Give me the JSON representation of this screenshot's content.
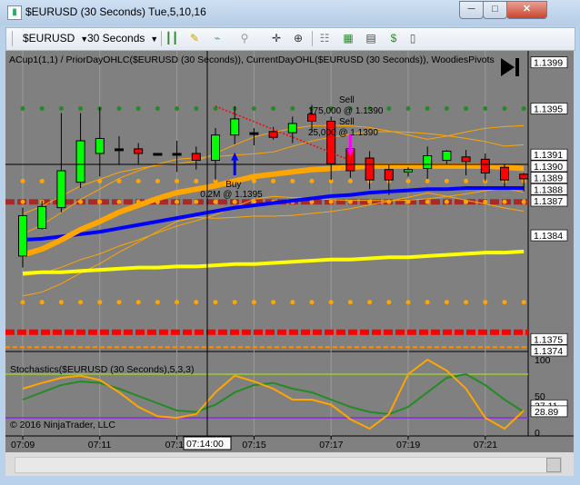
{
  "window": {
    "title": "$EURUSD (30 Seconds)  Tue,5,10,16",
    "minimize": "─",
    "maximize": "□",
    "close": "✕",
    "icon": "chart-app-icon"
  },
  "toolbar": {
    "instrument": "$EURUSD",
    "interval": "30 Seconds",
    "icons": [
      "bar-type-icon",
      "draw-pencil-icon",
      "indicator-add-icon",
      "crosshair-icon",
      "zoom-icon",
      "properties-icon",
      "data-box-icon",
      "strategy-icon",
      "order-entry-icon"
    ]
  },
  "chart": {
    "indicator_label": "ACup1(1,1) / PriorDayOHLC($EURUSD (30 Seconds)), CurrentDayOHL($EURUSD (30 Seconds)), WoodiesPivots",
    "price_ticks": [
      "1.1399",
      "1.1395",
      "1.1391",
      "1.1390",
      "1.1389",
      "1.1388",
      "1.1387",
      "1.1384",
      "1.1375",
      "1.1374"
    ],
    "annotations": {
      "buy_label": "Buy",
      "buy_detail": "0.2M @ 1.1395",
      "sell1_label": "Sell",
      "sell1_detail": "175,000 @ 1.1390",
      "sell2_label": "Sell",
      "sell2_detail": "25,000 @ 1.1390"
    },
    "stochastics_label": "Stochastics($EURUSD (30 Seconds),5,3,3)",
    "stoch_ticks": [
      "100",
      "50",
      "0"
    ],
    "stoch_values": [
      "37.11",
      "28.89"
    ],
    "copyright": "© 2016 NinjaTrader, LLC",
    "time_ticks": [
      "07:09",
      "07:11",
      "07:13",
      "07:15",
      "07:17",
      "07:19",
      "07:21"
    ],
    "crosshair_time": "07:14:00"
  },
  "chart_data": {
    "type": "candlestick",
    "instrument": "$EURUSD",
    "interval": "30 Seconds",
    "candles": [
      {
        "t": "07:09:00",
        "o": 1.13822,
        "h": 1.13864,
        "l": 1.13812,
        "c": 1.13857,
        "dir": "up"
      },
      {
        "t": "07:09:30",
        "o": 1.13846,
        "h": 1.1387,
        "l": 1.13845,
        "c": 1.13865,
        "dir": "up"
      },
      {
        "t": "07:10:00",
        "o": 1.13864,
        "h": 1.13946,
        "l": 1.1386,
        "c": 1.13896,
        "dir": "up"
      },
      {
        "t": "07:10:30",
        "o": 1.13886,
        "h": 1.13946,
        "l": 1.13881,
        "c": 1.13922,
        "dir": "up"
      },
      {
        "t": "07:11:00",
        "o": 1.13911,
        "h": 1.13951,
        "l": 1.13891,
        "c": 1.13924,
        "dir": "up"
      },
      {
        "t": "07:11:30",
        "o": 1.13915,
        "h": 1.13926,
        "l": 1.13901,
        "c": 1.13915,
        "dir": "doji"
      },
      {
        "t": "07:12:00",
        "o": 1.13915,
        "h": 1.1392,
        "l": 1.13902,
        "c": 1.13911,
        "dir": "down"
      },
      {
        "t": "07:12:30",
        "o": 1.13911,
        "h": 1.13911,
        "l": 1.13911,
        "c": 1.13911,
        "dir": "doji"
      },
      {
        "t": "07:13:00",
        "o": 1.13911,
        "h": 1.13922,
        "l": 1.13895,
        "c": 1.13911,
        "dir": "doji"
      },
      {
        "t": "07:13:30",
        "o": 1.13911,
        "h": 1.13917,
        "l": 1.13897,
        "c": 1.13905,
        "dir": "down"
      },
      {
        "t": "07:14:00",
        "o": 1.13905,
        "h": 1.13933,
        "l": 1.13888,
        "c": 1.13927,
        "dir": "up"
      },
      {
        "t": "07:14:30",
        "o": 1.13927,
        "h": 1.13952,
        "l": 1.13919,
        "c": 1.13941,
        "dir": "up"
      },
      {
        "t": "07:15:00",
        "o": 1.13929,
        "h": 1.13933,
        "l": 1.13918,
        "c": 1.13929,
        "dir": "doji"
      },
      {
        "t": "07:15:30",
        "o": 1.1393,
        "h": 1.13934,
        "l": 1.13923,
        "c": 1.13925,
        "dir": "down"
      },
      {
        "t": "07:16:00",
        "o": 1.13929,
        "h": 1.13943,
        "l": 1.1392,
        "c": 1.13937,
        "dir": "up"
      },
      {
        "t": "07:16:30",
        "o": 1.13945,
        "h": 1.13953,
        "l": 1.13929,
        "c": 1.13939,
        "dir": "down"
      },
      {
        "t": "07:17:00",
        "o": 1.13939,
        "h": 1.13943,
        "l": 1.13888,
        "c": 1.13902,
        "dir": "down"
      },
      {
        "t": "07:17:30",
        "o": 1.13915,
        "h": 1.13918,
        "l": 1.1389,
        "c": 1.13896,
        "dir": "down"
      },
      {
        "t": "07:18:00",
        "o": 1.13907,
        "h": 1.13913,
        "l": 1.1388,
        "c": 1.13888,
        "dir": "down"
      },
      {
        "t": "07:18:30",
        "o": 1.13897,
        "h": 1.13901,
        "l": 1.13875,
        "c": 1.13888,
        "dir": "down"
      },
      {
        "t": "07:19:00",
        "o": 1.13895,
        "h": 1.13899,
        "l": 1.13891,
        "c": 1.13897,
        "dir": "up"
      },
      {
        "t": "07:19:30",
        "o": 1.13898,
        "h": 1.13917,
        "l": 1.13889,
        "c": 1.13909,
        "dir": "up"
      },
      {
        "t": "07:20:00",
        "o": 1.13905,
        "h": 1.13914,
        "l": 1.13902,
        "c": 1.13913,
        "dir": "up"
      },
      {
        "t": "07:20:30",
        "o": 1.13908,
        "h": 1.13914,
        "l": 1.13892,
        "c": 1.13904,
        "dir": "down"
      },
      {
        "t": "07:21:00",
        "o": 1.13906,
        "h": 1.13911,
        "l": 1.13887,
        "c": 1.13894,
        "dir": "down"
      },
      {
        "t": "07:21:30",
        "o": 1.13899,
        "h": 1.13902,
        "l": 1.13882,
        "c": 1.13888,
        "dir": "down"
      },
      {
        "t": "07:22:00",
        "o": 1.13893,
        "h": 1.13894,
        "l": 1.13878,
        "c": 1.13889,
        "dir": "down"
      }
    ],
    "overlays": [
      {
        "name": "yellow-ma",
        "color": "#ffff00",
        "values": [
          1.13807,
          1.13808,
          1.13808,
          1.13809,
          1.1381,
          1.13811,
          1.13812,
          1.13812,
          1.13813,
          1.13813,
          1.13814,
          1.13815,
          1.13815,
          1.13816,
          1.13817,
          1.13818,
          1.13819,
          1.13819,
          1.1382,
          1.13821,
          1.13821,
          1.13822,
          1.13823,
          1.13824,
          1.13825,
          1.13825,
          1.13826
        ]
      },
      {
        "name": "blue-ma",
        "color": "#0000ff",
        "values": [
          1.13836,
          1.13837,
          1.13839,
          1.13841,
          1.13843,
          1.13846,
          1.13849,
          1.13852,
          1.13855,
          1.13858,
          1.13861,
          1.13864,
          1.13866,
          1.13868,
          1.1387,
          1.13872,
          1.13874,
          1.13875,
          1.13877,
          1.13878,
          1.13879,
          1.1388,
          1.1388,
          1.13881,
          1.13881,
          1.13881,
          1.13881
        ]
      },
      {
        "name": "orange-ma",
        "color": "#ffa500",
        "values": [
          1.13823,
          1.13828,
          1.13836,
          1.13845,
          1.13852,
          1.1386,
          1.13866,
          1.13872,
          1.13877,
          1.1388,
          1.13883,
          1.13887,
          1.13891,
          1.13893,
          1.13895,
          1.13897,
          1.13898,
          1.13899,
          1.139,
          1.139,
          1.139,
          1.139,
          1.139,
          1.139,
          1.139,
          1.13899,
          1.13898
        ]
      }
    ],
    "levels": [
      {
        "name": "dark-red-level",
        "value": 1.13869,
        "style": "dashed-thick"
      },
      {
        "name": "red-level",
        "value": 1.13756,
        "style": "dashed-thick"
      },
      {
        "name": "orange-dash-level",
        "value": 1.13743,
        "style": "dashed"
      },
      {
        "name": "green-dot-level",
        "value": 1.1395,
        "style": "dotted"
      },
      {
        "name": "orange-dot-level-upper",
        "value": 1.13887,
        "style": "dotted"
      },
      {
        "name": "orange-dot-level-lower",
        "value": 1.13869,
        "style": "dotted"
      },
      {
        "name": "orange-dot-level-low",
        "value": 1.13782,
        "style": "dotted"
      }
    ],
    "ylim": [
      1.1374,
      1.14
    ],
    "stochastics": {
      "period": [
        5,
        3,
        3
      ],
      "ylim": [
        0,
        100
      ],
      "k_color": "#ffa500",
      "d_color": "#228b22",
      "k": [
        60,
        68,
        75,
        78,
        72,
        55,
        35,
        22,
        20,
        25,
        55,
        78,
        70,
        60,
        45,
        45,
        38,
        18,
        5,
        25,
        80,
        100,
        85,
        60,
        20,
        5,
        30
      ],
      "d": [
        45,
        55,
        65,
        70,
        68,
        60,
        50,
        40,
        30,
        28,
        38,
        55,
        65,
        68,
        60,
        55,
        45,
        35,
        28,
        25,
        35,
        55,
        75,
        80,
        65,
        45,
        28
      ]
    }
  }
}
